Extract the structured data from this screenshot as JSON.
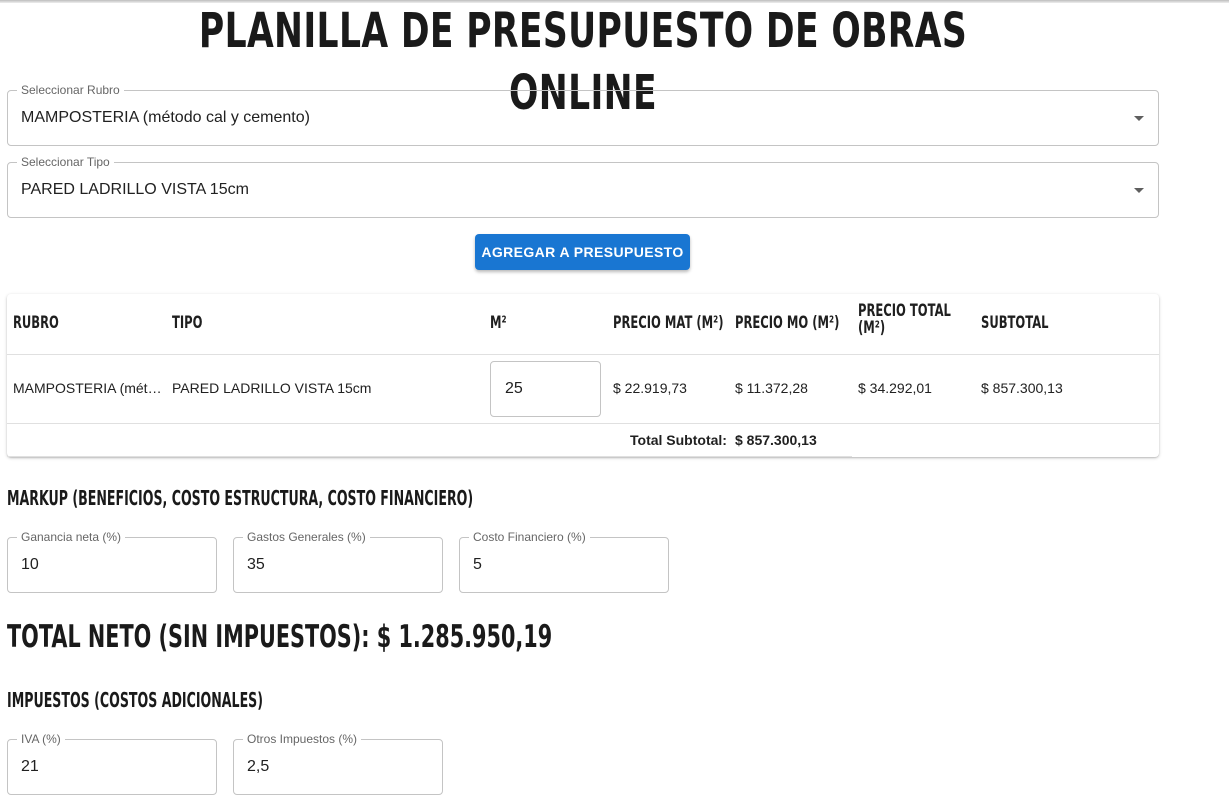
{
  "title": "PLANILLA DE PRESUPUESTO DE OBRAS ONLINE",
  "rubro_select": {
    "label": "Seleccionar Rubro",
    "value": "MAMPOSTERIA (método cal y cemento)"
  },
  "tipo_select": {
    "label": "Seleccionar Tipo",
    "value": "PARED LADRILLO VISTA 15cm"
  },
  "add_button": "AGREGAR A PRESUPUESTO",
  "table": {
    "headers": {
      "rubro": "RUBRO",
      "tipo": "TIPO",
      "m2": "M²",
      "precio_mat": "PRECIO MAT (M²)",
      "precio_mo": "PRECIO MO (M²)",
      "precio_total_line1": "PRECIO TOTAL",
      "precio_total_line2": "(M²)",
      "subtotal": "SUBTOTAL"
    },
    "rows": [
      {
        "rubro": "MAMPOSTERIA (mét…",
        "tipo": "PARED LADRILLO VISTA 15cm",
        "m2": "25",
        "precio_mat": "$ 22.919,73",
        "precio_mo": "$ 11.372,28",
        "precio_total": "$ 34.292,01",
        "subtotal": "$ 857.300,13"
      }
    ],
    "total_label": "Total Subtotal:",
    "total_value": "$ 857.300,13"
  },
  "markup": {
    "heading": "MARKUP (BENEFICIOS, COSTO ESTRUCTURA, COSTO FINANCIERO)",
    "ganancia": {
      "label": "Ganancia neta (%)",
      "value": "10"
    },
    "gastos": {
      "label": "Gastos Generales (%)",
      "value": "35"
    },
    "costo_fin": {
      "label": "Costo Financiero (%)",
      "value": "5"
    }
  },
  "total_neto": "TOTAL NETO (SIN IMPUESTOS): $ 1.285.950,19",
  "impuestos": {
    "heading": "IMPUESTOS (COSTOS ADICIONALES)",
    "iva": {
      "label": "IVA (%)",
      "value": "21"
    },
    "otros": {
      "label": "Otros Impuestos (%)",
      "value": "2,5"
    }
  },
  "colors": {
    "accent": "#1976d2",
    "border": "#c4c4c4",
    "label": "#666666"
  }
}
